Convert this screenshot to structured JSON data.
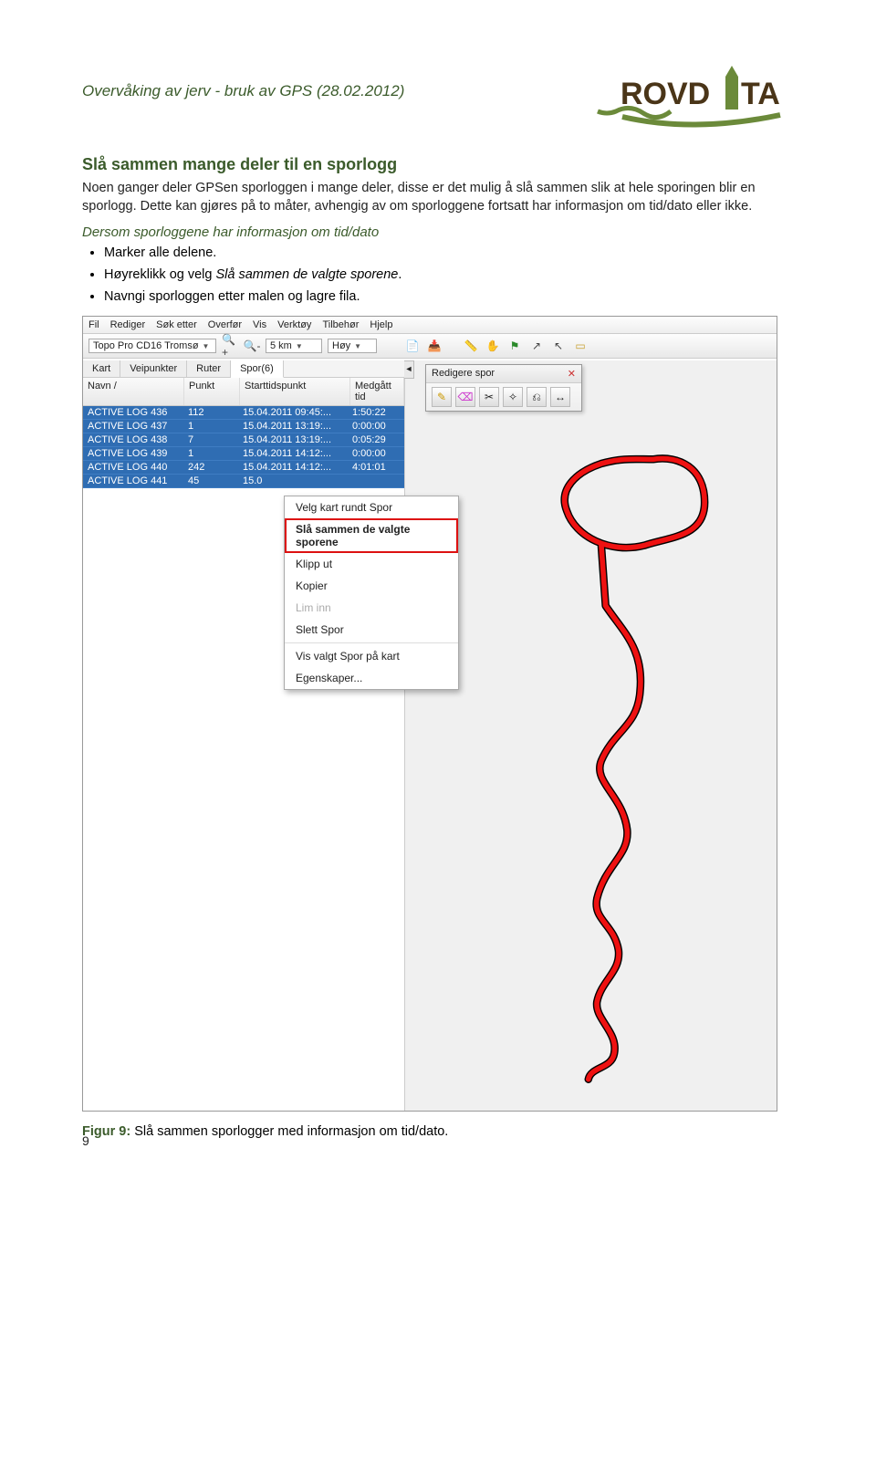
{
  "header": {
    "title": "Overvåking av jerv - bruk av GPS (28.02.2012)",
    "logo_text": "ROVDATA"
  },
  "section": {
    "heading": "Slå sammen mange deler til en sporlogg",
    "paragraph": "Noen ganger deler GPSen sporloggen i mange deler, disse er det mulig å slå sammen slik at hele sporingen blir en sporlogg. Dette kan gjøres på to måter, avhengig av om sporloggene fortsatt har informasjon om tid/dato eller ikke.",
    "subheading": "Dersom sporloggene har informasjon om tid/dato",
    "bullets": [
      "Marker alle delene.",
      "Høyreklikk og velg Slå sammen de valgte sporene.",
      "Navngi sporloggen etter malen og lagre fila."
    ],
    "bullet_italic_phrase": "Slå sammen de valgte sporene"
  },
  "app": {
    "menu": [
      "Fil",
      "Rediger",
      "Søk etter",
      "Overfør",
      "Vis",
      "Verktøy",
      "Tilbehør",
      "Hjelp"
    ],
    "map_combo": "Topo Pro CD16 Tromsø",
    "zoom_combo": "5 km",
    "quality_combo": "Høy",
    "panel_tabs": [
      "Kart",
      "Veipunkter",
      "Ruter",
      "Spor(6)"
    ],
    "active_panel_tab": 3,
    "columns": [
      "Navn",
      "Punkt",
      "Starttidspunkt",
      "Medgått tid"
    ],
    "rows": [
      {
        "name": "ACTIVE LOG 436",
        "punkt": "112",
        "start": "15.04.2011 09:45:...",
        "med": "1:50:22"
      },
      {
        "name": "ACTIVE LOG 437",
        "punkt": "1",
        "start": "15.04.2011 13:19:...",
        "med": "0:00:00"
      },
      {
        "name": "ACTIVE LOG 438",
        "punkt": "7",
        "start": "15.04.2011 13:19:...",
        "med": "0:05:29"
      },
      {
        "name": "ACTIVE LOG 439",
        "punkt": "1",
        "start": "15.04.2011 14:12:...",
        "med": "0:00:00"
      },
      {
        "name": "ACTIVE LOG 440",
        "punkt": "242",
        "start": "15.04.2011 14:12:...",
        "med": "4:01:01"
      },
      {
        "name": "ACTIVE LOG 441",
        "punkt": "45",
        "start": "15.0",
        "med": ""
      }
    ],
    "context_menu": {
      "items": [
        {
          "label": "Velg kart rundt Spor",
          "disabled": false
        },
        {
          "label": "Slå sammen de valgte sporene",
          "highlight": true
        },
        {
          "label": "Klipp ut"
        },
        {
          "label": "Kopier"
        },
        {
          "label": "Lim inn",
          "disabled": true
        },
        {
          "label": "Slett Spor"
        },
        {
          "sep": true
        },
        {
          "label": "Vis valgt Spor på kart"
        },
        {
          "label": "Egenskaper..."
        }
      ]
    },
    "float_palette_title": "Redigere spor",
    "collapse_glyph": "◄"
  },
  "figure": {
    "label": "Figur 9:",
    "caption": "Slå sammen sporlogger med informasjon om tid/dato."
  },
  "page_number": "9"
}
